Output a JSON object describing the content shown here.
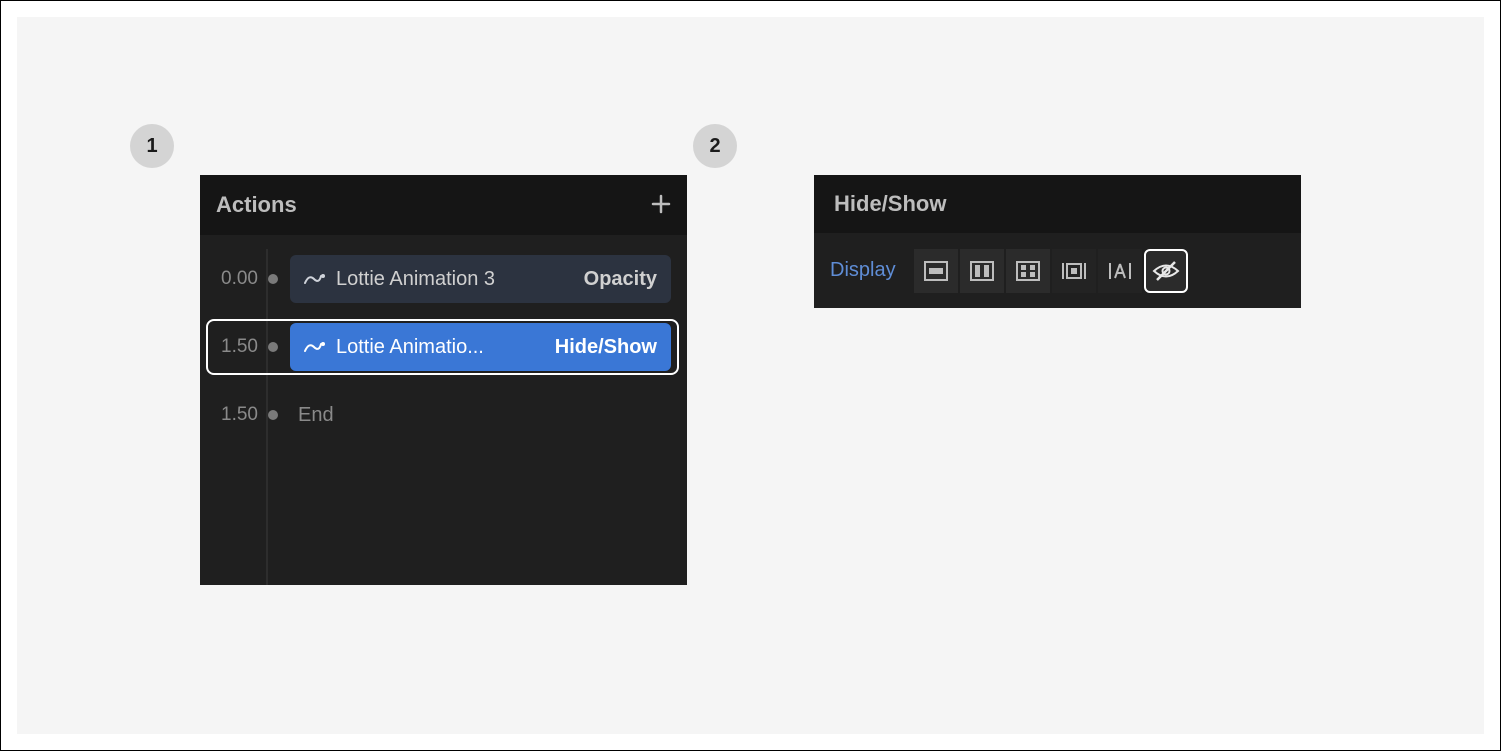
{
  "steps": {
    "one": "1",
    "two": "2"
  },
  "actions_panel": {
    "title": "Actions",
    "rows": [
      {
        "time": "0.00",
        "element": "Lottie Animation 3",
        "action": "Opacity"
      },
      {
        "time": "1.50",
        "element": "Lottie Animatio...",
        "action": "Hide/Show"
      },
      {
        "time": "1.50",
        "end": "End"
      }
    ]
  },
  "hideshow_panel": {
    "title": "Hide/Show",
    "display_label": "Display"
  }
}
